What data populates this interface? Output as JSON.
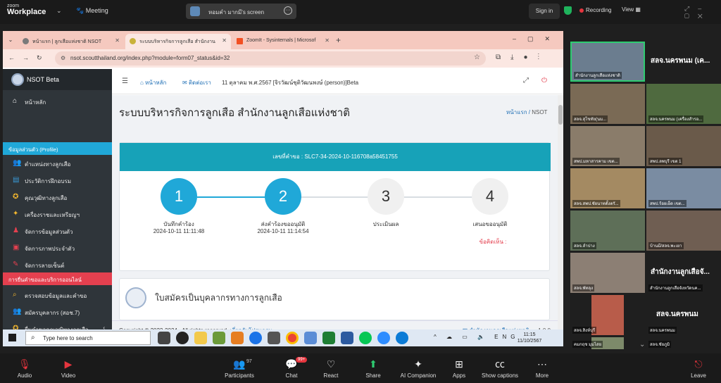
{
  "zoom": {
    "logo_top": "zoom",
    "logo_bottom": "Workplace",
    "meeting_label": "Meeting",
    "screen_share_label": "หอมคำ มากมี's screen",
    "sign_in": "Sign in",
    "recording": "Recording",
    "view": "View"
  },
  "browser": {
    "tabs": [
      {
        "label": "หน้าแรก | ลูกเสือแห่งชาติ NSOT",
        "favicon_color": "#7a7a7a"
      },
      {
        "label": "ระบบบริหารกิจการลูกเสือ สำนักงาน",
        "favicon_color": "#c9b23a"
      },
      {
        "label": "ZoomIt - Sysinternals | Microsof",
        "favicon_color": "#f25022"
      }
    ],
    "url": "nsot.scoutthailand.org/index.php?module=form07_status&id=32"
  },
  "sidebar": {
    "brand": "NSOT Beta",
    "home": "หน้าหลัก",
    "profile_header": "ข้อมูลส่วนตัว (Profile)",
    "items": [
      {
        "label": "ตำแหน่งทางลูกเสือ",
        "icon": "users-icon"
      },
      {
        "label": "ประวัติการฝึกอบรม",
        "icon": "id-card-icon"
      },
      {
        "label": "คุณวุฒิทางลูกเสือ",
        "icon": "award-icon"
      },
      {
        "label": "เครื่องราชและเหรียญฯ",
        "icon": "medal-icon"
      },
      {
        "label": "จัดการข้อมูลส่วนตัว",
        "icon": "user-edit-icon"
      },
      {
        "label": "จัดการภาพประจำตัว",
        "icon": "image-icon"
      },
      {
        "label": "จัดการลายเซ็นต์",
        "icon": "pen-icon"
      }
    ],
    "services_header": "การยื่นคำขอและบริการออนไลน์",
    "service_items": [
      {
        "label": "ตรวจสอบข้อมูลและคำขอ",
        "icon": "search-icon"
      },
      {
        "label": "สมัครบุคลากร (สอช.7)",
        "icon": "users-icon"
      },
      {
        "label": "ยื่นคำขอคุณวุฒิทางลูกเสือ",
        "icon": "award-icon"
      }
    ]
  },
  "header": {
    "home_link": "หน้าหลัก",
    "contact_link": "ติดต่อเรา",
    "date_user": "11 ตุลาคม พ.ศ.2567 [จิรวัฒน์ชุติวัฒนพงษ์ (person)]Beta"
  },
  "main": {
    "title": "ระบบบริหารกิจการลูกเสือ สำนักงานลูกเสือแห่งชาติ",
    "breadcrumb_home": "หน้าแรก",
    "breadcrumb_current": "NSOT",
    "request_no": "เลขที่คำขอ : SLC7-34-2024-10-116708a58451755",
    "steps": [
      {
        "num": "1",
        "label": "บันทึกคำร้อง",
        "date": "2024-10-11 11:11:48",
        "done": true
      },
      {
        "num": "2",
        "label": "ส่งคำร้องขออนุมัติ",
        "date": "2024-10-11 11:14:54",
        "done": true
      },
      {
        "num": "3",
        "label": "ประเมินผล",
        "date": "",
        "done": false
      },
      {
        "num": "4",
        "label": "เสนอขออนุมัติ",
        "date": "",
        "done": false
      }
    ],
    "comment_label": "ข้อคิดเห็น :",
    "form_title": "ใบสมัครเป็นบุคลากรทางการลูกเสือ"
  },
  "footer": {
    "copyright": "Copyright © 2022-2024 . All rights reserved.",
    "about": "เกี่ยวกับโปรแกรม",
    "org": "สำนักงานลูกเสือแห่งชาติ",
    "version": "1.0.0"
  },
  "taskbar": {
    "search_placeholder": "Type here to search",
    "lang": "ENG",
    "time": "11:15",
    "date": "11/10/2567"
  },
  "gallery": {
    "tiles": [
      {
        "name": "สำนักงานลูกเสือแห่งชาติ",
        "color": "#6b7d8f"
      },
      {
        "name": "สลจ.นครพนม (เค...",
        "big": true
      },
      {
        "name": "สลจ.สุโขทัย(นม...",
        "color": "#7a6a55"
      },
      {
        "name": "สลจ.นครพนม (เครื่องสำรอ...",
        "color": "#4f6a3f"
      },
      {
        "name": "สพป.มหาสารคาม เขต...",
        "color": "#8a7c6a"
      },
      {
        "name": "สพป.ลพบุรี เขต 1",
        "color": "#6a5a4a"
      },
      {
        "name": "สลจ.สพป.ชัยนาทตั้งตรั...",
        "color": "#a48a62"
      },
      {
        "name": "สพป.ร้อยเอ็ด เขต...",
        "color": "#7a8ca2"
      },
      {
        "name": "สลจ.ลำปาง",
        "color": "#5e6f58"
      },
      {
        "name": "บ้านมี/สลจ.พะเยา",
        "color": "#6f5e52"
      },
      {
        "name": "สลจ.พัทลุง",
        "color": "#8c7f74"
      },
      {
        "name": "สำนักงานลูกเสือจั...",
        "big": true,
        "sub": "สำนักงานลูกเสือจังหวัดนค..."
      },
      {
        "name": "สลจ.สิงห์บุรี",
        "color": "#b85c4a"
      },
      {
        "name": "สลจ.นครพนม",
        "big": true,
        "sub": "สลจ.นครพนม"
      },
      {
        "name": "คมกฤช มุมไสย",
        "color": "#7d8a6a"
      },
      {
        "name": "สลจ.ชัยภูมิ",
        "big": true,
        "sub": "สลจ.ชัยภูมิ"
      }
    ]
  },
  "controls": {
    "audio": "Audio",
    "video": "Video",
    "participants": "Participants",
    "participants_count": "97",
    "chat": "Chat",
    "chat_badge": "99+",
    "react": "React",
    "share": "Share",
    "ai": "AI Companion",
    "apps": "Apps",
    "captions": "Show captions",
    "more": "More",
    "leave": "Leave"
  }
}
